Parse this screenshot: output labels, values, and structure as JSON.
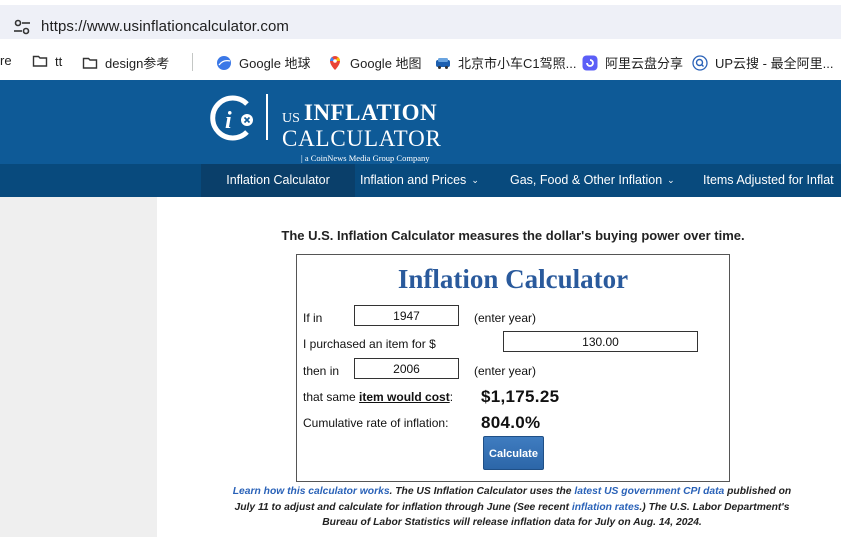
{
  "browser": {
    "url": "https://www.usinflationcalculator.com",
    "bookmarks": [
      {
        "label": "re",
        "icon": "share-icon"
      },
      {
        "label": "tt",
        "icon": "folder-icon"
      },
      {
        "label": "design参考",
        "icon": "folder-icon"
      },
      {
        "label": "Google 地球",
        "icon": "google-earth-icon"
      },
      {
        "label": "Google 地图",
        "icon": "google-maps-icon"
      },
      {
        "label": "北京市小车C1驾照...",
        "icon": "car-icon"
      },
      {
        "label": "阿里云盘分享",
        "icon": "aliyun-drive-icon"
      },
      {
        "label": "UP云搜 - 最全阿里...",
        "icon": "search-q-icon"
      }
    ]
  },
  "site": {
    "logo_us": "US",
    "logo_inflation": "INFLATION",
    "logo_calculator": "CALCULATOR",
    "logo_tagline": "| a CoinNews Media Group Company",
    "nav": [
      {
        "label": "Inflation Calculator",
        "has_dropdown": false
      },
      {
        "label": "Inflation and Prices",
        "has_dropdown": true
      },
      {
        "label": "Gas, Food & Other Inflation",
        "has_dropdown": true
      },
      {
        "label": "Items Adjusted for Inflat",
        "has_dropdown": false
      }
    ]
  },
  "main": {
    "intro": "The U.S. Inflation Calculator measures the dollar's buying power over time.",
    "calculator": {
      "title": "Inflation Calculator",
      "if_in_label": "If in",
      "start_year": "1947",
      "enter_year_hint": "(enter year)",
      "purchased_label": "I purchased an item for $",
      "amount": "130.00",
      "then_in_label": "then in",
      "end_year": "2006",
      "cost_prefix": "that same ",
      "cost_link": "item would cost",
      "cost_suffix": ":",
      "cost_value": "$1,175.25",
      "rate_label": "Cumulative rate of inflation:",
      "rate_value": "804.0%",
      "button": "Calculate"
    },
    "footnote": {
      "link1": "Learn how this calculator works",
      "text1": ". The US Inflation Calculator uses the ",
      "link2": "latest US government CPI data",
      "text2": " published on July 11 to adjust and calculate for inflation through June (See recent ",
      "link3": "inflation rates",
      "text3": ".) The U.S. Labor Department's Bureau of Labor Statistics will release inflation data for July on Aug. 14, 2024."
    }
  },
  "colors": {
    "header_blue": "#0e5a97",
    "nav_blue": "#084a7d",
    "title_blue": "#2a5a9c",
    "link_blue": "#2a62b8"
  }
}
